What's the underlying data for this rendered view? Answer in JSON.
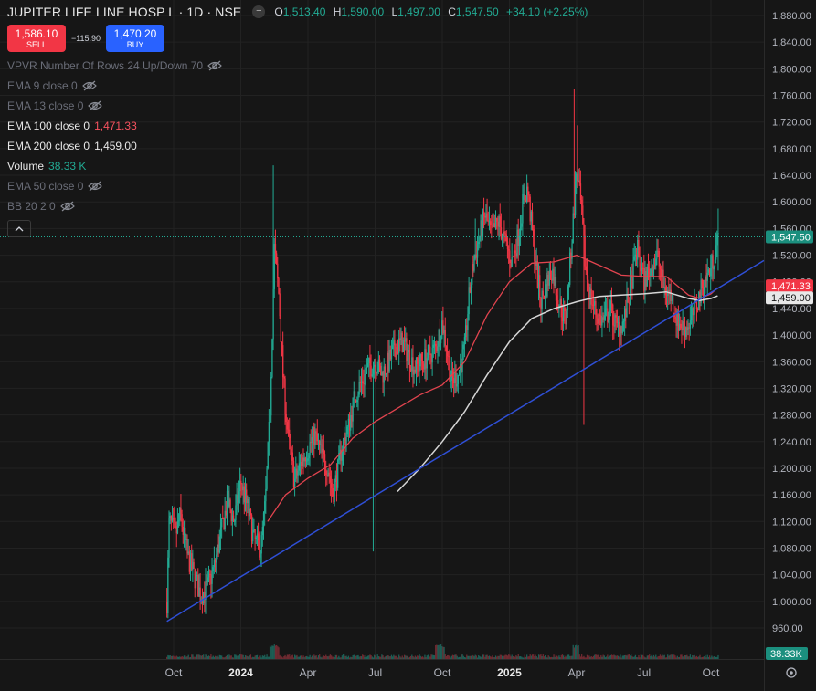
{
  "header": {
    "symbol": "JUPITER LIFE LINE HOSP L · 1D · NSE",
    "open_label": "O",
    "open": "1,513.40",
    "high_label": "H",
    "high": "1,590.00",
    "low_label": "L",
    "low": "1,497.00",
    "close_label": "C",
    "close": "1,547.50",
    "change": "+34.10 (+2.25%)"
  },
  "trade": {
    "sell_price": "1,586.10",
    "sell_label": "SELL",
    "spread": "−115.90",
    "buy_price": "1,470.20",
    "buy_label": "BUY"
  },
  "indicators": [
    {
      "name": "VPVR Number Of Rows 24 Up/Down 70",
      "value": "",
      "hidden": true
    },
    {
      "name": "EMA 9 close 0",
      "value": "",
      "hidden": true
    },
    {
      "name": "EMA 13 close 0",
      "value": "",
      "hidden": true
    },
    {
      "name": "EMA 100 close 0",
      "value": "1,471.33",
      "hidden": false,
      "color": "#f7525f"
    },
    {
      "name": "EMA 200 close 0",
      "value": "1,459.00",
      "hidden": false,
      "color": "#e8e8e8"
    },
    {
      "name": "Volume",
      "value": "38.33 K",
      "hidden": false,
      "color": "#22ab94"
    },
    {
      "name": "EMA 50 close 0",
      "value": "",
      "hidden": true
    },
    {
      "name": "BB 20 2 0",
      "value": "",
      "hidden": true
    }
  ],
  "colors": {
    "up": "#22ab94",
    "down": "#f23645",
    "ema100": "#e2444f",
    "ema200": "#d6d6d6",
    "trendline": "#2f4fd6",
    "background": "#161616",
    "grid": "#222222",
    "axis_text": "#b2b5be"
  },
  "chart_data": {
    "type": "candlestick",
    "symbol": "JUPITER LIFE LINE HOSP L",
    "interval": "1D",
    "exchange": "NSE",
    "y_ticks": [
      960,
      1000,
      1040,
      1080,
      1120,
      1160,
      1200,
      1240,
      1280,
      1320,
      1360,
      1400,
      1440,
      1480,
      1520,
      1560,
      1600,
      1640,
      1680,
      1720,
      1760,
      1800,
      1840,
      1880
    ],
    "y_tick_labels": [
      "960.00",
      "1,000.00",
      "1,040.00",
      "1,080.00",
      "1,120.00",
      "1,160.00",
      "1,200.00",
      "1,240.00",
      "1,280.00",
      "1,320.00",
      "1,360.00",
      "1,400.00",
      "1,440.00",
      "1,480.00",
      "1,520.00",
      "1,560.00",
      "1,600.00",
      "1,640.00",
      "1,680.00",
      "1,720.00",
      "1,760.00",
      "1,800.00",
      "1,840.00",
      "1,880.00"
    ],
    "ylim": [
      930,
      1900
    ],
    "x_ticks": [
      {
        "label": "Oct",
        "month": 0,
        "bold": false
      },
      {
        "label": "2024",
        "month": 3,
        "bold": true
      },
      {
        "label": "Apr",
        "month": 6,
        "bold": false
      },
      {
        "label": "Jul",
        "month": 9,
        "bold": false
      },
      {
        "label": "Oct",
        "month": 12,
        "bold": false
      },
      {
        "label": "2025",
        "month": 15,
        "bold": true
      },
      {
        "label": "Apr",
        "month": 18,
        "bold": false
      },
      {
        "label": "Jul",
        "month": 21,
        "bold": false
      },
      {
        "label": "Oct",
        "month": 24,
        "bold": false
      }
    ],
    "x_unit": "months since Oct 2023",
    "price_anchors": [
      [
        -0.3,
        1000
      ],
      [
        -0.2,
        1120
      ],
      [
        0.1,
        1100
      ],
      [
        0.3,
        1130
      ],
      [
        0.6,
        1070
      ],
      [
        0.9,
        1040
      ],
      [
        1.2,
        1010
      ],
      [
        1.5,
        1020
      ],
      [
        1.8,
        1050
      ],
      [
        2.1,
        1100
      ],
      [
        2.4,
        1150
      ],
      [
        2.7,
        1120
      ],
      [
        3.0,
        1180
      ],
      [
        3.3,
        1140
      ],
      [
        3.6,
        1090
      ],
      [
        3.9,
        1080
      ],
      [
        4.1,
        1150
      ],
      [
        4.3,
        1280
      ],
      [
        4.5,
        1530
      ],
      [
        4.7,
        1460
      ],
      [
        4.9,
        1330
      ],
      [
        5.1,
        1250
      ],
      [
        5.4,
        1180
      ],
      [
        5.7,
        1210
      ],
      [
        6.0,
        1230
      ],
      [
        6.3,
        1250
      ],
      [
        6.6,
        1220
      ],
      [
        6.9,
        1200
      ],
      [
        7.1,
        1160
      ],
      [
        7.3,
        1190
      ],
      [
        7.5,
        1230
      ],
      [
        7.8,
        1260
      ],
      [
        8.1,
        1310
      ],
      [
        8.4,
        1330
      ],
      [
        8.7,
        1350
      ],
      [
        9.0,
        1360
      ],
      [
        9.3,
        1340
      ],
      [
        9.6,
        1360
      ],
      [
        9.9,
        1380
      ],
      [
        10.2,
        1390
      ],
      [
        10.5,
        1370
      ],
      [
        10.8,
        1350
      ],
      [
        11.1,
        1360
      ],
      [
        11.4,
        1370
      ],
      [
        11.7,
        1380
      ],
      [
        12.0,
        1420
      ],
      [
        12.2,
        1380
      ],
      [
        12.4,
        1330
      ],
      [
        12.7,
        1340
      ],
      [
        13.0,
        1380
      ],
      [
        13.2,
        1460
      ],
      [
        13.4,
        1510
      ],
      [
        13.6,
        1540
      ],
      [
        13.9,
        1580
      ],
      [
        14.2,
        1550
      ],
      [
        14.5,
        1570
      ],
      [
        14.8,
        1540
      ],
      [
        15.1,
        1510
      ],
      [
        15.4,
        1550
      ],
      [
        15.6,
        1600
      ],
      [
        15.8,
        1620
      ],
      [
        16.0,
        1560
      ],
      [
        16.2,
        1500
      ],
      [
        16.4,
        1450
      ],
      [
        16.6,
        1470
      ],
      [
        16.9,
        1500
      ],
      [
        17.2,
        1450
      ],
      [
        17.5,
        1420
      ],
      [
        17.8,
        1550
      ],
      [
        18.0,
        1650
      ],
      [
        18.2,
        1590
      ],
      [
        18.4,
        1500
      ],
      [
        18.6,
        1460
      ],
      [
        18.9,
        1430
      ],
      [
        19.2,
        1420
      ],
      [
        19.5,
        1440
      ],
      [
        19.8,
        1410
      ],
      [
        20.1,
        1420
      ],
      [
        20.4,
        1470
      ],
      [
        20.7,
        1530
      ],
      [
        21.0,
        1480
      ],
      [
        21.3,
        1500
      ],
      [
        21.6,
        1520
      ],
      [
        21.9,
        1470
      ],
      [
        22.2,
        1460
      ],
      [
        22.5,
        1420
      ],
      [
        22.8,
        1410
      ],
      [
        23.1,
        1420
      ],
      [
        23.4,
        1450
      ],
      [
        23.7,
        1480
      ],
      [
        24.0,
        1500
      ],
      [
        24.2,
        1530
      ],
      [
        24.35,
        1547.5
      ]
    ],
    "ema100": [
      [
        4.2,
        1120
      ],
      [
        5.0,
        1160
      ],
      [
        6.0,
        1185
      ],
      [
        7.0,
        1205
      ],
      [
        8.0,
        1245
      ],
      [
        9.0,
        1270
      ],
      [
        10.0,
        1290
      ],
      [
        11.0,
        1310
      ],
      [
        12.0,
        1325
      ],
      [
        13.0,
        1360
      ],
      [
        14.0,
        1430
      ],
      [
        15.0,
        1480
      ],
      [
        16.0,
        1508
      ],
      [
        17.0,
        1510
      ],
      [
        18.0,
        1520
      ],
      [
        19.0,
        1505
      ],
      [
        20.0,
        1490
      ],
      [
        21.0,
        1488
      ],
      [
        22.0,
        1488
      ],
      [
        23.0,
        1460
      ],
      [
        23.5,
        1455
      ],
      [
        24.0,
        1462
      ],
      [
        24.3,
        1471.33
      ]
    ],
    "ema200": [
      [
        10.0,
        1165
      ],
      [
        11.0,
        1200
      ],
      [
        12.0,
        1240
      ],
      [
        13.0,
        1285
      ],
      [
        14.0,
        1340
      ],
      [
        15.0,
        1390
      ],
      [
        16.0,
        1425
      ],
      [
        17.0,
        1440
      ],
      [
        18.0,
        1450
      ],
      [
        19.0,
        1458
      ],
      [
        20.0,
        1460
      ],
      [
        21.0,
        1462
      ],
      [
        22.0,
        1465
      ],
      [
        23.0,
        1455
      ],
      [
        23.5,
        1452
      ],
      [
        24.0,
        1455
      ],
      [
        24.3,
        1459.0
      ]
    ],
    "trendline": {
      "start": [
        -0.3,
        970
      ],
      "end": [
        26.5,
        1512
      ]
    },
    "last_price": {
      "value": 1547.5,
      "label": "1,547.50"
    },
    "ema100_last": {
      "value": 1471.33,
      "label": "1,471.33"
    },
    "ema200_last": {
      "value": 1459.0,
      "label": "1,459.00"
    },
    "volume_last": "38.33 K"
  }
}
